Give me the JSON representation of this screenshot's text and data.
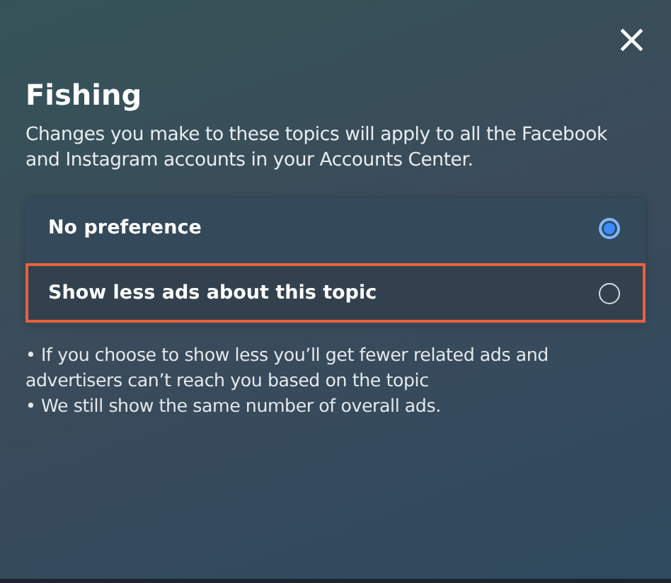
{
  "close_button": "×",
  "title": "Fishing",
  "description": "Changes you make to these topics will apply to all the Facebook and Instagram accounts in your Accounts Center.",
  "options": [
    {
      "label": "No preference",
      "selected": true,
      "highlighted": false
    },
    {
      "label": "Show less ads about this topic",
      "selected": false,
      "highlighted": true
    }
  ],
  "notes": [
    "• If you choose to show less you’ll get fewer related ads and advertisers can’t reach you based on the topic",
    "• We still show the same number of overall ads."
  ]
}
